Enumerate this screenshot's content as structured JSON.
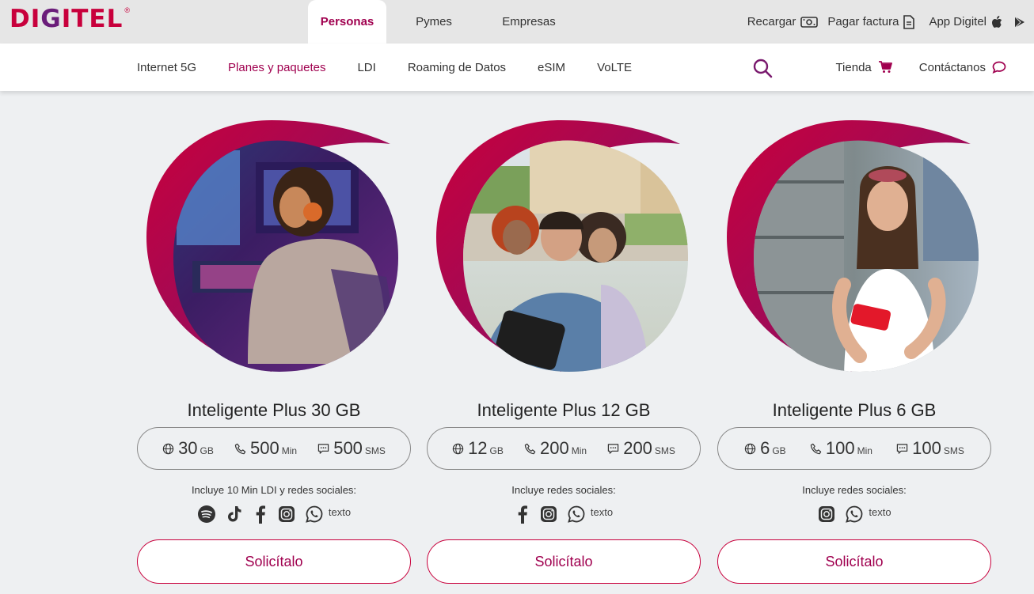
{
  "brand": {
    "logo_text": "DIGITEL",
    "primary_color": "#c8003c",
    "accent_color": "#a0004f",
    "purple_color": "#6b1d7a"
  },
  "top_segments": [
    "Personas",
    "Pymes",
    "Empresas"
  ],
  "top_active": "Personas",
  "utility": {
    "recargar": "Recargar",
    "pagar_factura": "Pagar factura",
    "app": "App Digitel"
  },
  "nav": {
    "links": [
      "Internet 5G",
      "Planes y paquetes",
      "LDI",
      "Roaming de Datos",
      "eSIM",
      "VoLTE"
    ],
    "active": "Planes y paquetes",
    "tienda": "Tienda",
    "contactanos": "Contáctanos"
  },
  "plans": [
    {
      "title": "Inteligente Plus 30 GB",
      "image": "gamer-with-headset",
      "data": "30",
      "data_unit": "GB",
      "minutes": "500",
      "minutes_unit": "Min",
      "sms": "500",
      "sms_unit": "SMS",
      "includes": "Incluye 10 Min LDI y redes sociales:",
      "social_icons": [
        "spotify-icon",
        "tiktok-icon",
        "facebook-icon",
        "instagram-icon",
        "whatsapp-icon"
      ],
      "texto_label": "texto",
      "cta": "Solicítalo"
    },
    {
      "title": "Inteligente Plus 12 GB",
      "image": "friends-selfie",
      "data": "12",
      "data_unit": "GB",
      "minutes": "200",
      "minutes_unit": "Min",
      "sms": "200",
      "sms_unit": "SMS",
      "includes": "Incluye redes sociales:",
      "social_icons": [
        "facebook-icon",
        "instagram-icon",
        "whatsapp-icon"
      ],
      "texto_label": "texto",
      "cta": "Solicítalo"
    },
    {
      "title": "Inteligente Plus 6 GB",
      "image": "woman-with-phone",
      "data": "6",
      "data_unit": "GB",
      "minutes": "100",
      "minutes_unit": "Min",
      "sms": "100",
      "sms_unit": "SMS",
      "includes": "Incluye redes sociales:",
      "social_icons": [
        "instagram-icon",
        "whatsapp-icon"
      ],
      "texto_label": "texto",
      "cta": "Solicítalo"
    }
  ]
}
